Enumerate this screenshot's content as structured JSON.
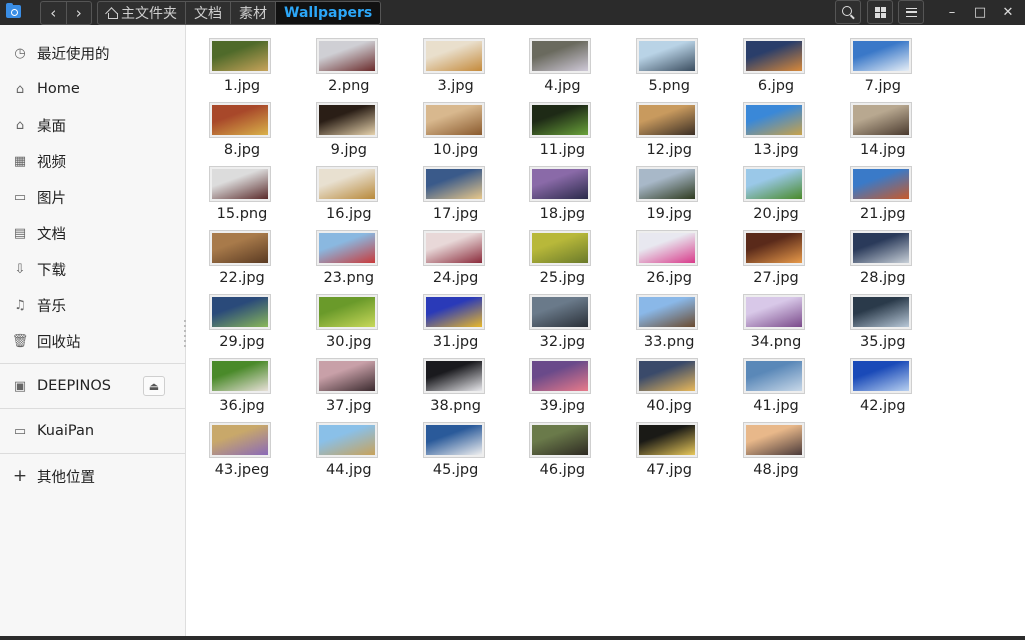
{
  "header": {
    "back_icon": "chevron-left",
    "forward_icon": "chevron-right",
    "breadcrumbs": [
      {
        "label": "主文件夹",
        "icon": "home-icon"
      },
      {
        "label": "文档"
      },
      {
        "label": "素材"
      },
      {
        "label": "Wallpapers",
        "active": true
      }
    ],
    "buttons": [
      "search-icon",
      "view-mode-icon",
      "menu-icon"
    ],
    "window_controls": {
      "minimize": "–",
      "maximize": "□",
      "close": "✕"
    }
  },
  "sidebar": {
    "items": [
      {
        "label": "最近使用的",
        "icon": "clock-icon",
        "glyph": "◷"
      },
      {
        "label": "Home",
        "icon": "home-icon",
        "glyph": "⌂"
      },
      {
        "label": "桌面",
        "icon": "desktop-icon",
        "glyph": "⌂"
      },
      {
        "label": "视频",
        "icon": "video-icon",
        "glyph": "▦"
      },
      {
        "label": "图片",
        "icon": "picture-icon",
        "glyph": "▭"
      },
      {
        "label": "文档",
        "icon": "document-icon",
        "glyph": "▤"
      },
      {
        "label": "下载",
        "icon": "download-icon",
        "glyph": "⇩"
      },
      {
        "label": "音乐",
        "icon": "music-icon",
        "glyph": "♫"
      },
      {
        "label": "回收站",
        "icon": "trash-icon",
        "glyph": "🗑"
      }
    ],
    "devices": [
      {
        "label": "DEEPINOS",
        "icon": "drive-icon",
        "glyph": "▣",
        "eject_glyph": "⏏"
      }
    ],
    "network": [
      {
        "label": "KuaiPan",
        "icon": "network-drive-icon",
        "glyph": "▭"
      }
    ],
    "other": {
      "label": "其他位置",
      "icon": "plus-icon",
      "glyph": "+"
    }
  },
  "files": [
    {
      "name": "1.jpg",
      "c1": "#4f6a2a",
      "c2": "#c7a35a"
    },
    {
      "name": "2.png",
      "c1": "#cfcfd4",
      "c2": "#6a2a2a"
    },
    {
      "name": "3.jpg",
      "c1": "#e9dfcc",
      "c2": "#c48a3b"
    },
    {
      "name": "4.jpg",
      "c1": "#6a6a5e",
      "c2": "#cfc9d8"
    },
    {
      "name": "5.png",
      "c1": "#b9d3e6",
      "c2": "#3a4c5e"
    },
    {
      "name": "6.jpg",
      "c1": "#2a3e6a",
      "c2": "#d8893a"
    },
    {
      "name": "7.jpg",
      "c1": "#3a78c8",
      "c2": "#e6eef6"
    },
    {
      "name": "8.jpg",
      "c1": "#a8482a",
      "c2": "#d9b24a"
    },
    {
      "name": "9.jpg",
      "c1": "#2a1e16",
      "c2": "#e6d2ac"
    },
    {
      "name": "10.jpg",
      "c1": "#d8b88e",
      "c2": "#8a5a2e"
    },
    {
      "name": "11.jpg",
      "c1": "#1e2a16",
      "c2": "#6aa23a"
    },
    {
      "name": "12.jpg",
      "c1": "#c89a5e",
      "c2": "#3a2e24"
    },
    {
      "name": "13.jpg",
      "c1": "#3a88d8",
      "c2": "#c8a24a"
    },
    {
      "name": "14.jpg",
      "c1": "#b8a890",
      "c2": "#4a3a2e"
    },
    {
      "name": "15.png",
      "c1": "#dcdcdc",
      "c2": "#5a2a2a"
    },
    {
      "name": "16.jpg",
      "c1": "#e8e0d0",
      "c2": "#b8893a"
    },
    {
      "name": "17.jpg",
      "c1": "#3a5a8a",
      "c2": "#e8c88a"
    },
    {
      "name": "18.jpg",
      "c1": "#8a6aa8",
      "c2": "#2a2a4a"
    },
    {
      "name": "19.jpg",
      "c1": "#a8b8c8",
      "c2": "#2e3a1e"
    },
    {
      "name": "20.jpg",
      "c1": "#9ac8e8",
      "c2": "#4a8a2a"
    },
    {
      "name": "21.jpg",
      "c1": "#3a7ac8",
      "c2": "#c85a2a"
    },
    {
      "name": "22.jpg",
      "c1": "#a87a4a",
      "c2": "#5a3a22"
    },
    {
      "name": "23.png",
      "c1": "#8ab8e0",
      "c2": "#c83a3a"
    },
    {
      "name": "24.jpg",
      "c1": "#e8d8d8",
      "c2": "#8a2a3a"
    },
    {
      "name": "25.jpg",
      "c1": "#b8b83a",
      "c2": "#6a7a2a"
    },
    {
      "name": "26.jpg",
      "c1": "#e8e8f0",
      "c2": "#d83a8a"
    },
    {
      "name": "27.jpg",
      "c1": "#5a2a1a",
      "c2": "#e89a4a"
    },
    {
      "name": "28.jpg",
      "c1": "#2a3a5a",
      "c2": "#c8d0d8"
    },
    {
      "name": "29.jpg",
      "c1": "#2a4a7a",
      "c2": "#8ab85a"
    },
    {
      "name": "30.jpg",
      "c1": "#6a9a2a",
      "c2": "#c8d85a"
    },
    {
      "name": "31.jpg",
      "c1": "#2a3ab8",
      "c2": "#e8b82a"
    },
    {
      "name": "32.jpg",
      "c1": "#6a7a8a",
      "c2": "#2a3038"
    },
    {
      "name": "33.png",
      "c1": "#8ab8e8",
      "c2": "#6a4a2e"
    },
    {
      "name": "34.png",
      "c1": "#d8c8e8",
      "c2": "#7a4a8a"
    },
    {
      "name": "35.jpg",
      "c1": "#2a3a4a",
      "c2": "#b8c8d8"
    },
    {
      "name": "36.jpg",
      "c1": "#4a8a2a",
      "c2": "#e8e0d8"
    },
    {
      "name": "37.jpg",
      "c1": "#c8a0a8",
      "c2": "#3a2a2e"
    },
    {
      "name": "38.png",
      "c1": "#1a1a1e",
      "c2": "#e8e8ec"
    },
    {
      "name": "39.jpg",
      "c1": "#6a4a8a",
      "c2": "#e87a8a"
    },
    {
      "name": "40.jpg",
      "c1": "#3a4a6a",
      "c2": "#e8b85a"
    },
    {
      "name": "41.jpg",
      "c1": "#5a88b8",
      "c2": "#c8d8e8"
    },
    {
      "name": "42.jpg",
      "c1": "#1a4ab8",
      "c2": "#b8d0f0"
    },
    {
      "name": "43.jpeg",
      "c1": "#c8a86a",
      "c2": "#8a6ab8"
    },
    {
      "name": "44.jpg",
      "c1": "#8ac0e8",
      "c2": "#c8a25a"
    },
    {
      "name": "45.jpg",
      "c1": "#2a5a9a",
      "c2": "#f0f0f0"
    },
    {
      "name": "46.jpg",
      "c1": "#6a7a4a",
      "c2": "#2e2a22"
    },
    {
      "name": "47.jpg",
      "c1": "#1a1a16",
      "c2": "#e8c85a"
    },
    {
      "name": "48.jpg",
      "c1": "#e8b88a",
      "c2": "#4a3a3a"
    }
  ]
}
